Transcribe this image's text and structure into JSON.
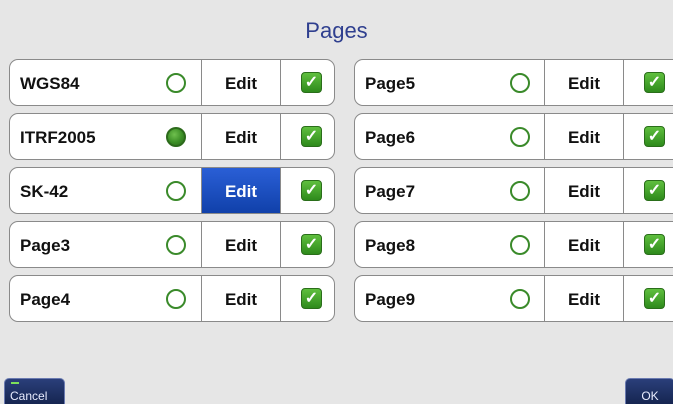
{
  "title": "Pages",
  "left_rows": [
    {
      "name": "WGS84",
      "selected": false,
      "edit_label": "Edit",
      "checked": true
    },
    {
      "name": "ITRF2005",
      "selected": true,
      "edit_label": "Edit",
      "checked": true
    },
    {
      "name": "SK-42",
      "selected": false,
      "edit_label": "Edit",
      "checked": true
    },
    {
      "name": "Page3",
      "selected": false,
      "edit_label": "Edit",
      "checked": true
    },
    {
      "name": "Page4",
      "selected": false,
      "edit_label": "Edit",
      "checked": true
    }
  ],
  "right_rows": [
    {
      "name": "Page5",
      "selected": false,
      "edit_label": "Edit",
      "checked": true
    },
    {
      "name": "Page6",
      "selected": false,
      "edit_label": "Edit",
      "checked": true
    },
    {
      "name": "Page7",
      "selected": false,
      "edit_label": "Edit",
      "checked": true
    },
    {
      "name": "Page8",
      "selected": false,
      "edit_label": "Edit",
      "checked": true
    },
    {
      "name": "Page9",
      "selected": false,
      "edit_label": "Edit",
      "checked": true
    }
  ],
  "active_edit": "SK-42",
  "buttons": {
    "cancel": "Cancel",
    "ok": "OK"
  },
  "colors": {
    "title": "#2f3f8f",
    "active_edit": "#1a4fc4",
    "radio_on": "#3c8f26",
    "check": "#3a9a26"
  }
}
